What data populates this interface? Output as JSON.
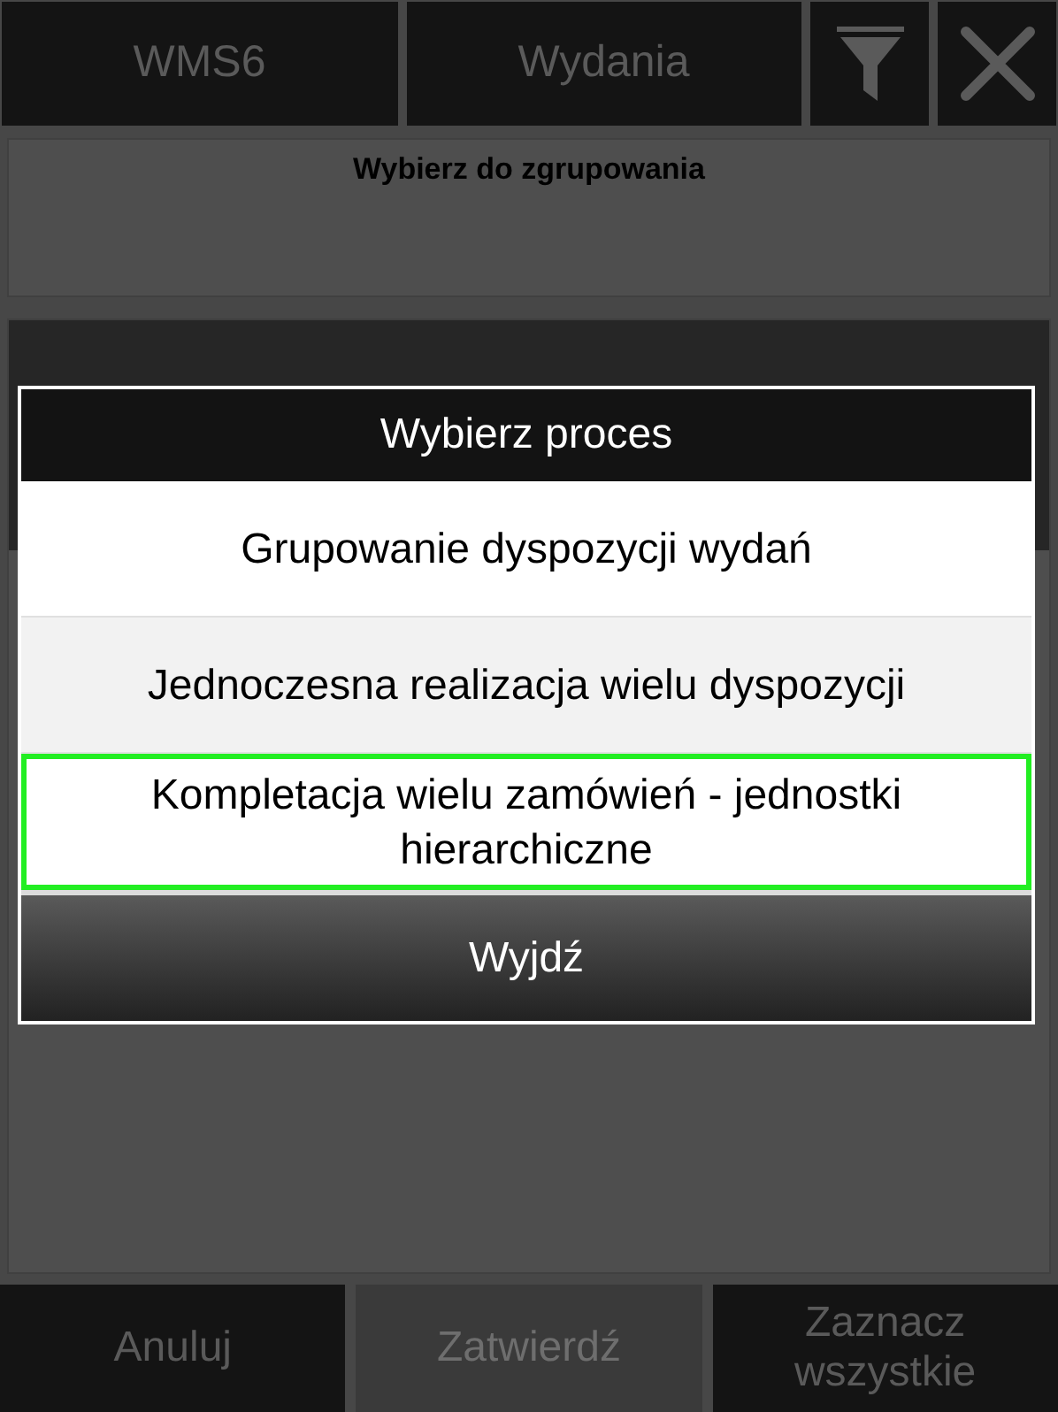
{
  "top_bar": {
    "buttons": [
      {
        "label": "WMS6"
      },
      {
        "label": "Wydania"
      }
    ]
  },
  "group_panel": {
    "title": "Wybierz do zgrupowania"
  },
  "dialog": {
    "title": "Wybierz proces",
    "options": [
      {
        "label": "Grupowanie dyspozycji wydań",
        "selected": false
      },
      {
        "label": "Jednoczesna realizacja wielu dyspozycji",
        "selected": false
      },
      {
        "label": "Kompletacja wielu zamówień - jednostki hierarchiczne",
        "selected": true
      }
    ],
    "exit_button": "Wyjdź"
  },
  "bottom_bar": [
    {
      "label": "Anuluj",
      "disabled": false
    },
    {
      "label": "Zatwierdź",
      "disabled": true
    },
    {
      "label": "Zaznacz wszystkie",
      "disabled": false
    }
  ]
}
